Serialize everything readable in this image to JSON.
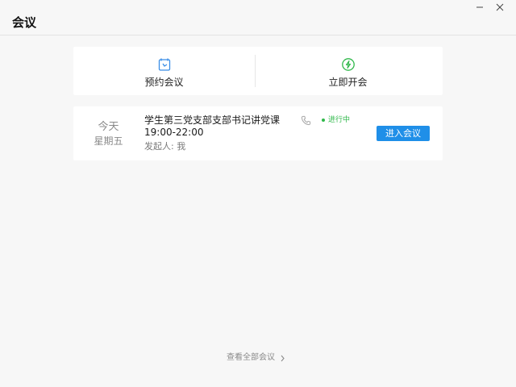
{
  "window": {
    "title": "会议",
    "minimize_icon": "minimize-icon",
    "close_icon": "close-icon"
  },
  "quick_actions": [
    {
      "label": "预约会议",
      "icon": "calendar-clock-icon",
      "color": "#3a8ee6"
    },
    {
      "label": "立即开会",
      "icon": "lightning-circle-icon",
      "color": "#2fb84a"
    }
  ],
  "meeting": {
    "day": "今天",
    "weekday": "星期五",
    "title": "学生第三党支部支部书记讲党课",
    "phone_icon": "phone-icon",
    "status": "进行中",
    "status_color": "#2fb84a",
    "time": "19:00-22:00",
    "organizer": "发起人: 我",
    "join_label": "进入会议",
    "join_color": "#1f8fe8"
  },
  "footer": {
    "view_all_label": "查看全部会议",
    "chevron_icon": "chevron-right-icon"
  }
}
